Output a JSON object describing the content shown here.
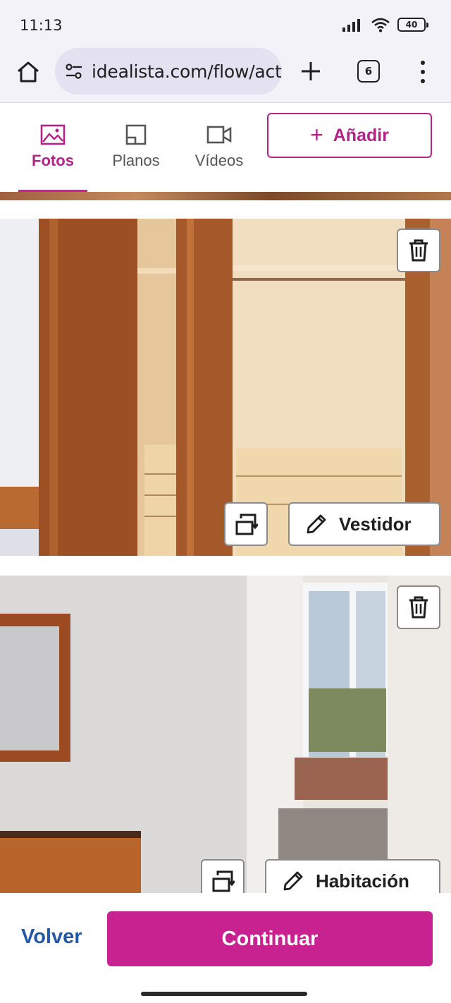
{
  "status_bar": {
    "time": "11:13",
    "battery": "40"
  },
  "browser": {
    "url": "idealista.com/flow/act",
    "tab_count": "6"
  },
  "tabs": [
    {
      "label": "Fotos",
      "icon": "image-icon",
      "active": true
    },
    {
      "label": "Planos",
      "icon": "floorplan-icon",
      "active": false
    },
    {
      "label": "Vídeos",
      "icon": "video-icon",
      "active": false
    }
  ],
  "add_button": {
    "label": "Añadir"
  },
  "photos": [
    {
      "label": "Vestidor"
    },
    {
      "label": "Habitación"
    }
  ],
  "footer": {
    "back_label": "Volver",
    "continue_label": "Continuar"
  },
  "colors": {
    "accent": "#c7228f",
    "link": "#2557a7",
    "browser_bg": "#f3f2f9"
  }
}
